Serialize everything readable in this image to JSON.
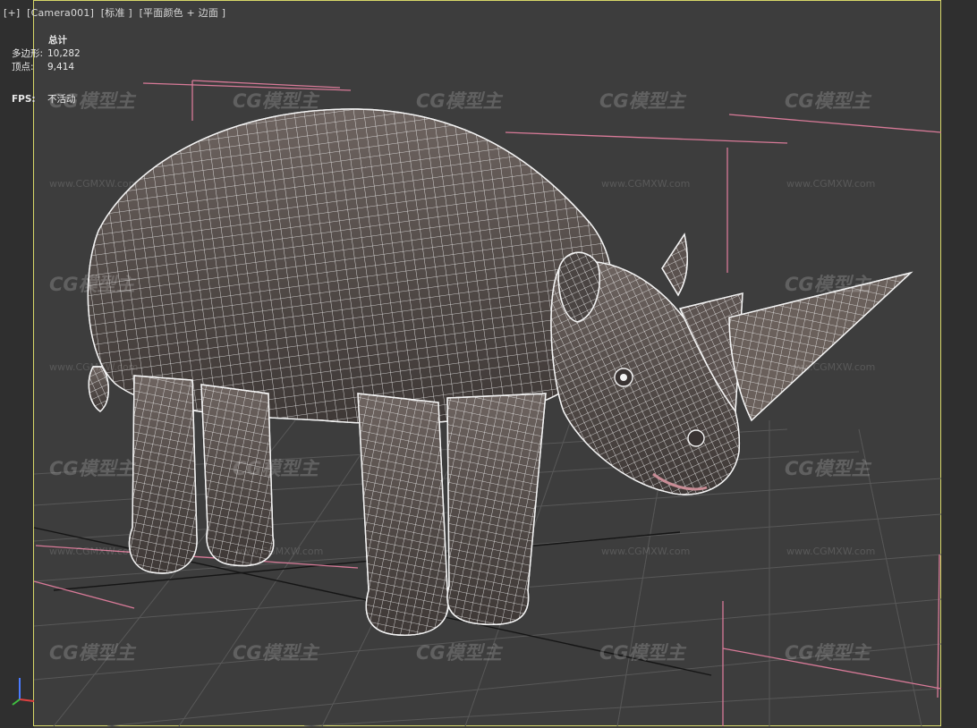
{
  "viewport": {
    "labels": [
      "[+]",
      "[Camera001]",
      "[标准 ]",
      "[平面颜色 + 边面 ]"
    ]
  },
  "stats": {
    "header": "总计",
    "polygons_label": "多边形:",
    "polygons_value": "10,282",
    "vertices_label": "顶点:",
    "vertices_value": "9,414"
  },
  "fps": {
    "label": "FPS:",
    "value": "不活动"
  },
  "watermark": {
    "brand": "CG模型主",
    "url": "www.CGMXW.com"
  },
  "colors": {
    "viewport_border": "#d7d768",
    "background": "#3d3d3d",
    "wireframe": "#f2f2f2",
    "camera_frustum": "#d87a98",
    "grid": "#555555"
  },
  "model": {
    "subject": "rhinoceros",
    "display": "wireframe-over-shaded"
  }
}
